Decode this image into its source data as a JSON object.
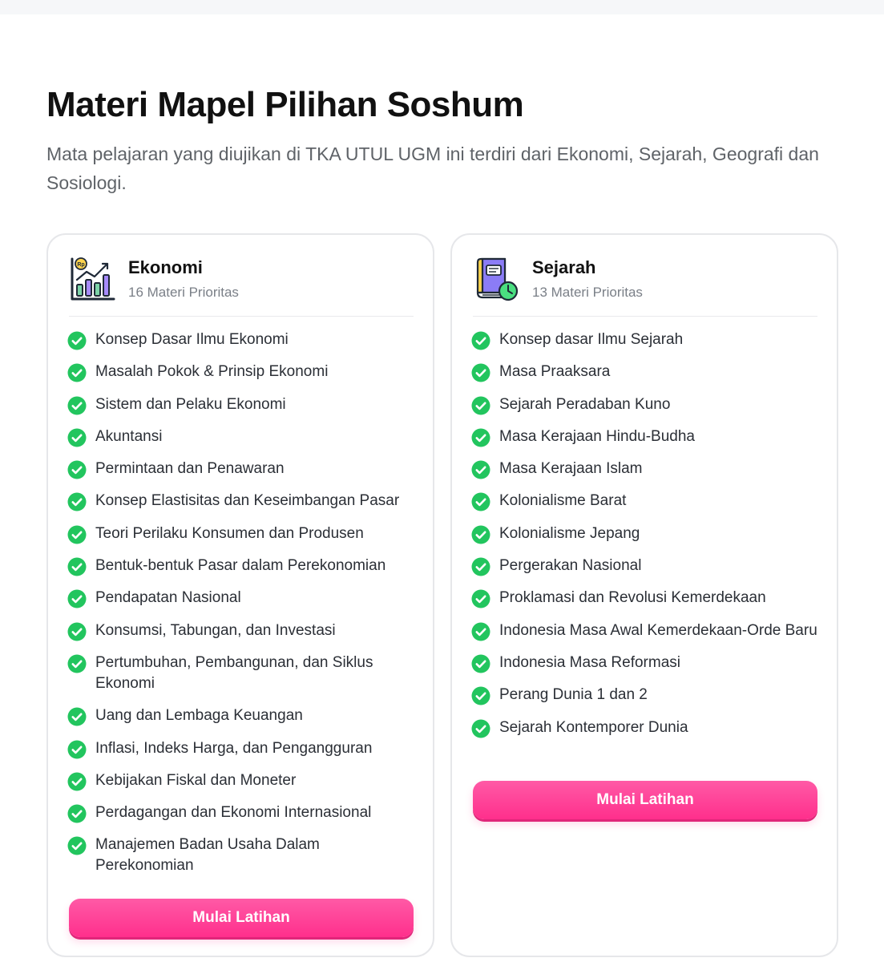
{
  "header": {
    "title": "Materi Mapel Pilihan Soshum",
    "subtitle": "Mata pelajaran yang diujikan di TKA UTUL UGM ini terdiri dari Ekonomi, Sejarah, Geografi dan Sosiologi."
  },
  "cards": [
    {
      "title": "Ekonomi",
      "count": "16 Materi Prioritas",
      "icon": "economy-chart-icon",
      "button_label": "Mulai Latihan",
      "topics": [
        "Konsep Dasar Ilmu Ekonomi",
        "Masalah Pokok & Prinsip Ekonomi",
        "Sistem dan Pelaku Ekonomi",
        "Akuntansi",
        "Permintaan dan Penawaran",
        "Konsep Elastisitas dan Keseimbangan Pasar",
        "Teori Perilaku Konsumen dan Produsen",
        "Bentuk-bentuk Pasar dalam Perekonomian",
        "Pendapatan Nasional",
        "Konsumsi, Tabungan, dan Investasi",
        "Pertumbuhan, Pembangunan, dan Siklus Ekonomi",
        "Uang dan Lembaga Keuangan",
        "Inflasi, Indeks Harga, dan Pengangguran",
        "Kebijakan Fiskal dan Moneter",
        "Perdagangan dan Ekonomi Internasional",
        "Manajemen Badan Usaha Dalam Perekonomian"
      ]
    },
    {
      "title": "Sejarah",
      "count": "13 Materi Prioritas",
      "icon": "history-book-clock-icon",
      "button_label": "Mulai Latihan",
      "topics": [
        "Konsep dasar Ilmu Sejarah",
        "Masa Praaksara",
        "Sejarah Peradaban Kuno",
        "Masa Kerajaan Hindu-Budha",
        "Masa Kerajaan Islam",
        "Kolonialisme Barat",
        "Kolonialisme Jepang",
        "Pergerakan Nasional",
        "Proklamasi dan Revolusi Kemerdekaan",
        "Indonesia Masa Awal Kemerdekaan-Orde Baru",
        "Indonesia Masa Reformasi",
        "Perang Dunia 1 dan 2",
        "Sejarah Kontemporer Dunia"
      ]
    }
  ],
  "colors": {
    "accent": "#ff2f8c",
    "check": "#22c55e",
    "title": "#111111",
    "muted": "#7a7f87"
  }
}
